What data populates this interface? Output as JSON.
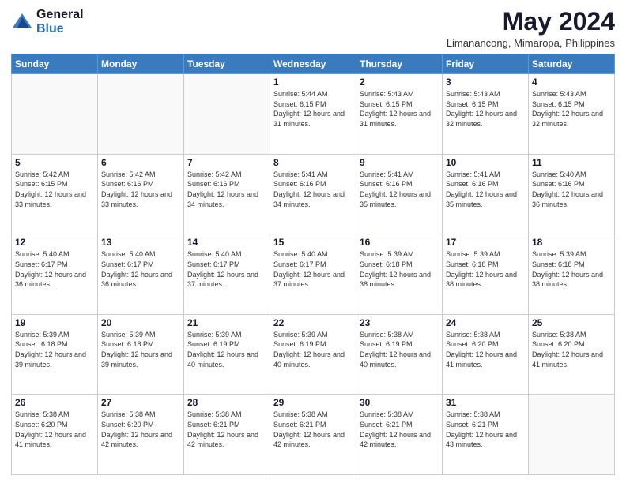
{
  "logo": {
    "general": "General",
    "blue": "Blue"
  },
  "header": {
    "month_year": "May 2024",
    "location": "Limanancong, Mimaropa, Philippines"
  },
  "days_of_week": [
    "Sunday",
    "Monday",
    "Tuesday",
    "Wednesday",
    "Thursday",
    "Friday",
    "Saturday"
  ],
  "weeks": [
    [
      {
        "day": "",
        "info": ""
      },
      {
        "day": "",
        "info": ""
      },
      {
        "day": "",
        "info": ""
      },
      {
        "day": "1",
        "info": "Sunrise: 5:44 AM\nSunset: 6:15 PM\nDaylight: 12 hours and 31 minutes."
      },
      {
        "day": "2",
        "info": "Sunrise: 5:43 AM\nSunset: 6:15 PM\nDaylight: 12 hours and 31 minutes."
      },
      {
        "day": "3",
        "info": "Sunrise: 5:43 AM\nSunset: 6:15 PM\nDaylight: 12 hours and 32 minutes."
      },
      {
        "day": "4",
        "info": "Sunrise: 5:43 AM\nSunset: 6:15 PM\nDaylight: 12 hours and 32 minutes."
      }
    ],
    [
      {
        "day": "5",
        "info": "Sunrise: 5:42 AM\nSunset: 6:15 PM\nDaylight: 12 hours and 33 minutes."
      },
      {
        "day": "6",
        "info": "Sunrise: 5:42 AM\nSunset: 6:16 PM\nDaylight: 12 hours and 33 minutes."
      },
      {
        "day": "7",
        "info": "Sunrise: 5:42 AM\nSunset: 6:16 PM\nDaylight: 12 hours and 34 minutes."
      },
      {
        "day": "8",
        "info": "Sunrise: 5:41 AM\nSunset: 6:16 PM\nDaylight: 12 hours and 34 minutes."
      },
      {
        "day": "9",
        "info": "Sunrise: 5:41 AM\nSunset: 6:16 PM\nDaylight: 12 hours and 35 minutes."
      },
      {
        "day": "10",
        "info": "Sunrise: 5:41 AM\nSunset: 6:16 PM\nDaylight: 12 hours and 35 minutes."
      },
      {
        "day": "11",
        "info": "Sunrise: 5:40 AM\nSunset: 6:16 PM\nDaylight: 12 hours and 36 minutes."
      }
    ],
    [
      {
        "day": "12",
        "info": "Sunrise: 5:40 AM\nSunset: 6:17 PM\nDaylight: 12 hours and 36 minutes."
      },
      {
        "day": "13",
        "info": "Sunrise: 5:40 AM\nSunset: 6:17 PM\nDaylight: 12 hours and 36 minutes."
      },
      {
        "day": "14",
        "info": "Sunrise: 5:40 AM\nSunset: 6:17 PM\nDaylight: 12 hours and 37 minutes."
      },
      {
        "day": "15",
        "info": "Sunrise: 5:40 AM\nSunset: 6:17 PM\nDaylight: 12 hours and 37 minutes."
      },
      {
        "day": "16",
        "info": "Sunrise: 5:39 AM\nSunset: 6:18 PM\nDaylight: 12 hours and 38 minutes."
      },
      {
        "day": "17",
        "info": "Sunrise: 5:39 AM\nSunset: 6:18 PM\nDaylight: 12 hours and 38 minutes."
      },
      {
        "day": "18",
        "info": "Sunrise: 5:39 AM\nSunset: 6:18 PM\nDaylight: 12 hours and 38 minutes."
      }
    ],
    [
      {
        "day": "19",
        "info": "Sunrise: 5:39 AM\nSunset: 6:18 PM\nDaylight: 12 hours and 39 minutes."
      },
      {
        "day": "20",
        "info": "Sunrise: 5:39 AM\nSunset: 6:18 PM\nDaylight: 12 hours and 39 minutes."
      },
      {
        "day": "21",
        "info": "Sunrise: 5:39 AM\nSunset: 6:19 PM\nDaylight: 12 hours and 40 minutes."
      },
      {
        "day": "22",
        "info": "Sunrise: 5:39 AM\nSunset: 6:19 PM\nDaylight: 12 hours and 40 minutes."
      },
      {
        "day": "23",
        "info": "Sunrise: 5:38 AM\nSunset: 6:19 PM\nDaylight: 12 hours and 40 minutes."
      },
      {
        "day": "24",
        "info": "Sunrise: 5:38 AM\nSunset: 6:20 PM\nDaylight: 12 hours and 41 minutes."
      },
      {
        "day": "25",
        "info": "Sunrise: 5:38 AM\nSunset: 6:20 PM\nDaylight: 12 hours and 41 minutes."
      }
    ],
    [
      {
        "day": "26",
        "info": "Sunrise: 5:38 AM\nSunset: 6:20 PM\nDaylight: 12 hours and 41 minutes."
      },
      {
        "day": "27",
        "info": "Sunrise: 5:38 AM\nSunset: 6:20 PM\nDaylight: 12 hours and 42 minutes."
      },
      {
        "day": "28",
        "info": "Sunrise: 5:38 AM\nSunset: 6:21 PM\nDaylight: 12 hours and 42 minutes."
      },
      {
        "day": "29",
        "info": "Sunrise: 5:38 AM\nSunset: 6:21 PM\nDaylight: 12 hours and 42 minutes."
      },
      {
        "day": "30",
        "info": "Sunrise: 5:38 AM\nSunset: 6:21 PM\nDaylight: 12 hours and 42 minutes."
      },
      {
        "day": "31",
        "info": "Sunrise: 5:38 AM\nSunset: 6:21 PM\nDaylight: 12 hours and 43 minutes."
      },
      {
        "day": "",
        "info": ""
      }
    ]
  ]
}
